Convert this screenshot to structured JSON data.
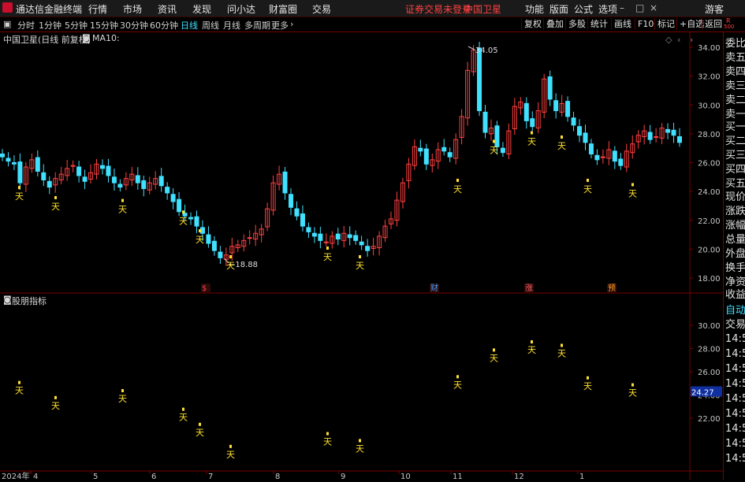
{
  "app": {
    "title": "通达信金融终端",
    "warning": "证券交易未登录",
    "stock_name_top": "中国卫星"
  },
  "menu": [
    "行情",
    "市场",
    "资讯",
    "发现",
    "问小达",
    "财富圈",
    "交易"
  ],
  "right_menu": [
    "功能",
    "版面",
    "公式",
    "选项"
  ],
  "guest": "游客",
  "r_badge": {
    "top": "R",
    "bottom": "500"
  },
  "periods": [
    "分时",
    "1分钟",
    "5分钟",
    "15分钟",
    "30分钟",
    "60分钟",
    "日线",
    "周线",
    "月线",
    "多周期",
    "更多"
  ],
  "active_period": "日线",
  "toolbar_right": [
    "复权",
    "叠加",
    "多股",
    "统计",
    "画线",
    "F10",
    "标记",
    "+自选",
    "返回"
  ],
  "main_chart": {
    "header": "中国卫星(日线 前复权)",
    "ma_label": "MA10:"
  },
  "sub_chart": {
    "header": "股朋指标"
  },
  "colors": {
    "up": "#ff4040",
    "down": "#40e0ff",
    "marker": "#ffe030",
    "grid": "#7a0000",
    "axis_text": "#c8c8c8"
  },
  "chart_data": {
    "type": "candlestick",
    "x_labels": [
      "2024年",
      "4",
      "5",
      "6",
      "7",
      "8",
      "9",
      "10",
      "11",
      "12",
      "1"
    ],
    "y_ticks_main": [
      "34.00",
      "32.00",
      "30.00",
      "28.00",
      "26.00",
      "24.00",
      "22.00",
      "20.00",
      "18.00"
    ],
    "y_ticks_sub": [
      "30.00",
      "28.00",
      "26.00",
      "24.00",
      "22.00"
    ],
    "sub_last_value": "24.27",
    "annotations": {
      "high": "34.05",
      "low": "18.88"
    },
    "marker_text": "天",
    "events": [
      {
        "month": "7",
        "label": "$"
      },
      {
        "month": "11",
        "label": "财"
      },
      {
        "month": "12",
        "label": "涨"
      },
      {
        "month": "1",
        "label": "预"
      }
    ],
    "close_series": [
      26.4,
      26.1,
      25.9,
      24.6,
      25.7,
      26.2,
      25.4,
      24.8,
      24.3,
      24.9,
      25.2,
      25.6,
      25.8,
      25.1,
      24.7,
      25.3,
      25.9,
      25.6,
      25.1,
      24.6,
      24.3,
      24.9,
      25.2,
      24.6,
      24.2,
      24.6,
      24.9,
      24.4,
      23.9,
      23.3,
      22.6,
      22.3,
      22.1,
      21.6,
      21.1,
      20.4,
      19.9,
      19.4,
      19.6,
      20.2,
      20.3,
      20.6,
      20.8,
      21.1,
      21.4,
      22.8,
      24.6,
      25.2,
      23.9,
      22.9,
      22.3,
      21.6,
      21.2,
      20.9,
      20.6,
      20.5,
      20.9,
      20.7,
      21.1,
      20.8,
      20.6,
      20.3,
      19.9,
      20.2,
      20.9,
      21.6,
      22.1,
      23.4,
      24.6,
      25.9,
      27.1,
      26.8,
      25.9,
      26.2,
      26.9,
      26.8,
      26.4,
      27.6,
      29.2,
      32.4,
      33.8,
      29.6,
      28.1,
      28.4,
      27.1,
      26.7,
      28.2,
      29.9,
      30.2,
      28.9,
      28.5,
      29.6,
      31.8,
      30.4,
      29.6,
      30.1,
      29.2,
      28.6,
      27.9,
      27.4,
      26.6,
      26.2,
      26.4,
      26.9,
      26.1,
      25.8,
      26.8,
      27.3,
      27.9,
      28.2,
      27.6,
      27.8,
      28.4,
      28.1,
      27.9,
      27.4
    ],
    "marker_positions_main": [
      [
        24,
        24.0
      ],
      [
        70,
        23.3
      ],
      [
        155,
        23.1
      ],
      [
        232,
        22.3
      ],
      [
        253,
        21.0
      ],
      [
        292,
        19.2
      ],
      [
        415,
        19.8
      ],
      [
        456,
        19.2
      ],
      [
        580,
        24.5
      ],
      [
        626,
        27.2
      ],
      [
        674,
        27.8
      ],
      [
        712,
        27.5
      ],
      [
        745,
        24.5
      ],
      [
        802,
        24.2
      ]
    ],
    "marker_positions_sub": [
      [
        24,
        24.8
      ],
      [
        70,
        23.5
      ],
      [
        155,
        24.1
      ],
      [
        232,
        22.5
      ],
      [
        253,
        21.2
      ],
      [
        292,
        19.3
      ],
      [
        415,
        20.4
      ],
      [
        456,
        19.8
      ],
      [
        580,
        25.3
      ],
      [
        626,
        27.6
      ],
      [
        674,
        28.3
      ],
      [
        712,
        28.0
      ],
      [
        745,
        25.2
      ],
      [
        802,
        24.6
      ]
    ]
  }
}
